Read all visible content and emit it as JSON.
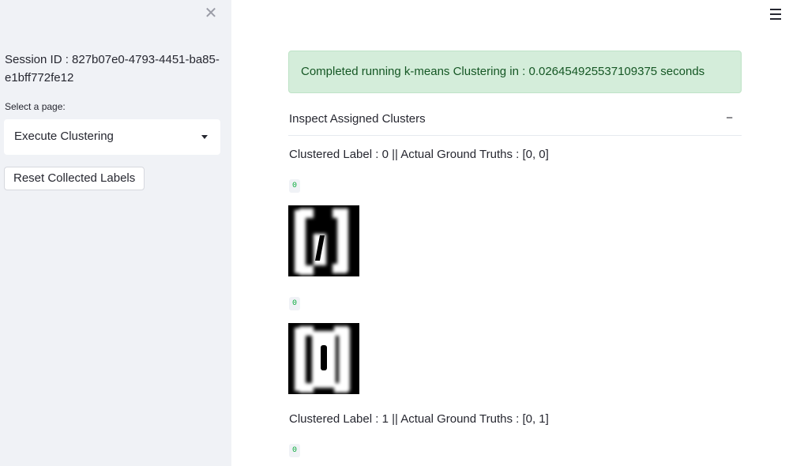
{
  "sidebar": {
    "close_icon": "close-icon",
    "session_id": "Session ID : 827b07e0-4793-4451-ba85-e1bff772fe12",
    "select_label": "Select a page:",
    "select_value": "Execute Clustering",
    "reset_button": "Reset Collected Labels"
  },
  "header": {
    "menu_icon": "hamburger-menu-icon"
  },
  "main": {
    "alert": "Completed running k-means Clustering in : 0.026454925537109375 seconds",
    "alert_color": "#d4edda",
    "expander": {
      "title": "Inspect Assigned Clusters",
      "toggle": "−"
    },
    "clusters": [
      {
        "heading": "Clustered Label : 0 || Actual Ground Truths : [0, 0]",
        "items": [
          {
            "badge": "0",
            "image": "digit-zero-image"
          },
          {
            "badge": "0",
            "image": "digit-zero-image"
          }
        ]
      },
      {
        "heading": "Clustered Label : 1 || Actual Ground Truths : [0, 1]",
        "items": [
          {
            "badge": "0"
          }
        ]
      }
    ]
  }
}
